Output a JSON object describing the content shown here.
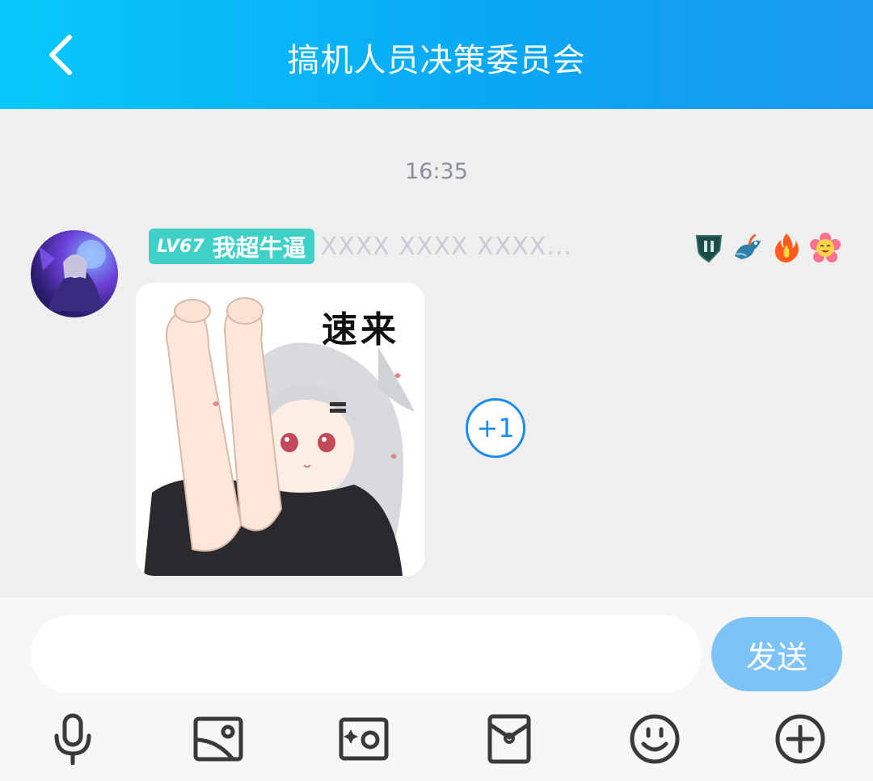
{
  "header": {
    "title": "搞机人员决策委员会",
    "back_icon": "chevron-left-icon",
    "gradient_start": "#07c8fb",
    "gradient_end": "#1b98f2"
  },
  "chat": {
    "timestamp": "16:35",
    "message": {
      "level": "LV67",
      "nickname": "我超牛逼",
      "redacted_text": "XXXX XXXX XXXX...",
      "badge_icons": [
        "shield-rank-icon",
        "dragon-icon",
        "fire-icon",
        "smiley-flower-icon"
      ],
      "sticker_caption": "速来",
      "plus_one_label": "+1"
    }
  },
  "composer": {
    "input_value": "",
    "send_label": "发送",
    "send_color": "#7ec3f6",
    "tools": [
      "microphone-icon",
      "image-icon",
      "camera-icon",
      "red-packet-icon",
      "emoji-icon",
      "plus-circle-icon"
    ]
  }
}
